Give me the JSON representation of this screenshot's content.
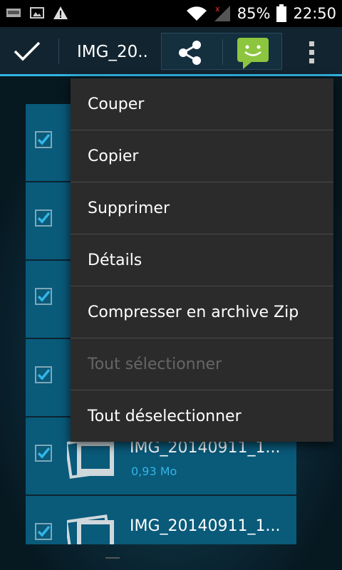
{
  "status_bar": {
    "battery_percent": "85%",
    "time": "22:50",
    "icons": [
      "app-notification-icon",
      "image-notification-icon",
      "warning-icon",
      "wifi-icon",
      "signal-no-service-icon",
      "battery-icon"
    ]
  },
  "action_bar": {
    "title": "IMG_20..",
    "icons": [
      "done-check-icon",
      "share-icon",
      "messaging-app-icon",
      "overflow-menu-icon"
    ]
  },
  "colors": {
    "accent": "#33b5e5",
    "action_bar_bg": "#12242f",
    "menu_bg": "#2b2b2b",
    "row_bg": "#0a5a7a",
    "sms_green": "#8cc63f"
  },
  "file_list": {
    "rows": [
      {
        "name": "",
        "size": ""
      },
      {
        "name": "",
        "size": ""
      },
      {
        "name": "",
        "size": ""
      },
      {
        "name": "",
        "size": ""
      },
      {
        "name": "IMG_20140911_1...",
        "size": "0,93 Mo"
      },
      {
        "name": "IMG_20140911_1...",
        "size": ""
      }
    ]
  },
  "menu": {
    "items": [
      {
        "label": "Couper",
        "enabled": true
      },
      {
        "label": "Copier",
        "enabled": true
      },
      {
        "label": "Supprimer",
        "enabled": true
      },
      {
        "label": "Détails",
        "enabled": true
      },
      {
        "label": "Compresser en archive Zip",
        "enabled": true
      },
      {
        "label": "Tout sélectionner",
        "enabled": false
      },
      {
        "label": "Tout déselectionner",
        "enabled": true
      }
    ]
  }
}
